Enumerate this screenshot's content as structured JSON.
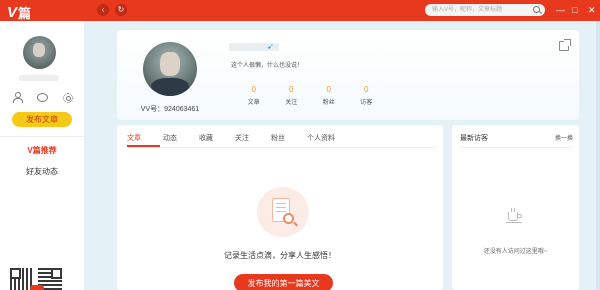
{
  "app": {
    "logo_mark": "V",
    "logo_text": "篇"
  },
  "topbar": {
    "back_icon": "‹",
    "refresh_icon": "↻",
    "search_placeholder": "输入V号，昵称，文章标题",
    "window_controls": [
      "—",
      "□",
      "✕"
    ]
  },
  "sidebar": {
    "publish_label": "发布文章",
    "nav": [
      {
        "label": "V篇推荐",
        "active": true
      },
      {
        "label": "好友动态",
        "active": false
      }
    ]
  },
  "profile": {
    "signature": "这个人很懒，什么也没说！",
    "vid": "VV号：924063461",
    "stats": [
      {
        "value": "0",
        "label": "文章"
      },
      {
        "value": "0",
        "label": "关注"
      },
      {
        "value": "0",
        "label": "粉丝"
      },
      {
        "value": "0",
        "label": "访客"
      }
    ]
  },
  "articles": {
    "tabs": [
      "文章",
      "动态",
      "收藏",
      "关注",
      "粉丝",
      "个人资料"
    ],
    "active_tab": "文章",
    "empty_text": "记录生活点滴，分享人生感悟！",
    "first_post_label": "发布我的第一篇美文"
  },
  "visitors": {
    "title": "最新访客",
    "refresh_label": "换一换",
    "empty_text": "还没有人访问过这里哦~"
  },
  "colors": {
    "brand_red": "#e8391f",
    "publish_yellow": "#f6c818",
    "stat_orange": "#f39b1b",
    "page_bg": "#e4f1f6"
  }
}
